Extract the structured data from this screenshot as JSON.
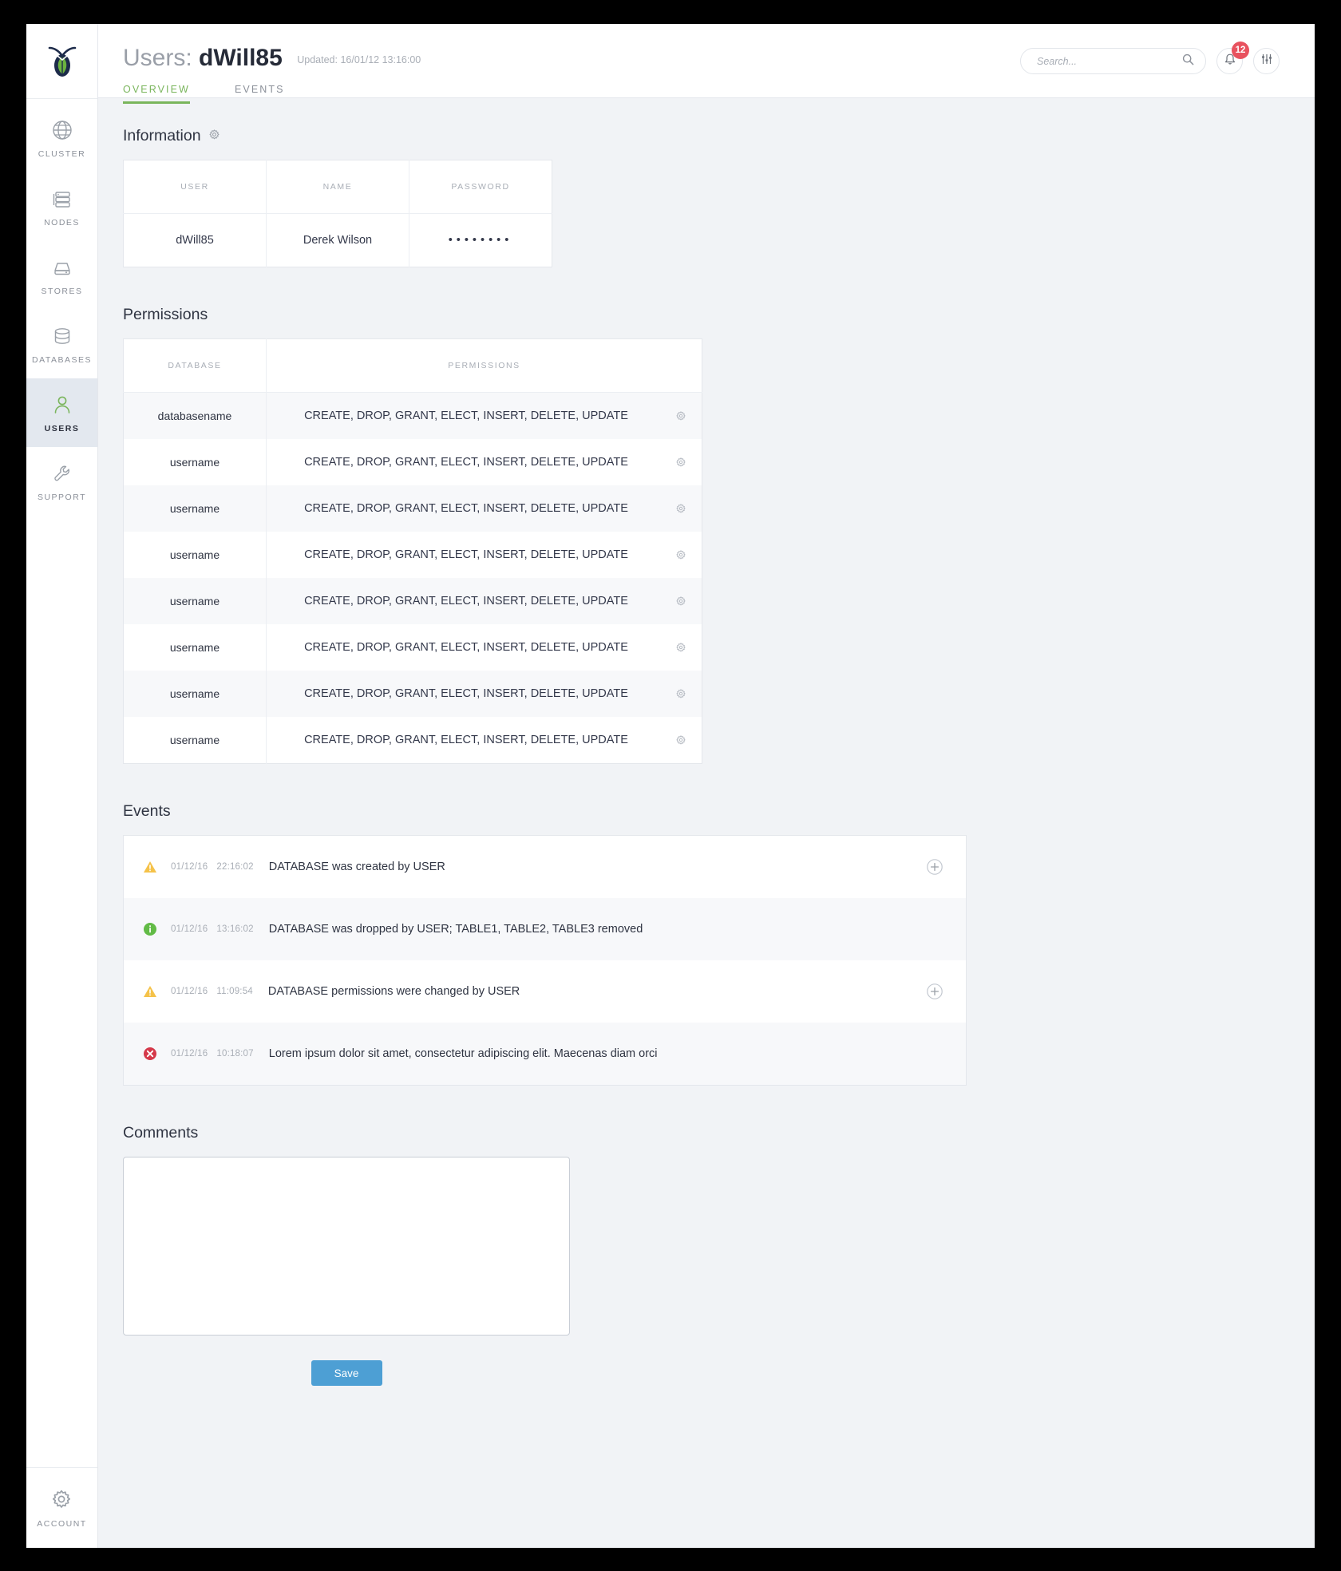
{
  "sidebar": {
    "logo_name": "cockroach-logo",
    "items": [
      {
        "label": "CLUSTER",
        "icon": "globe-icon",
        "active": false
      },
      {
        "label": "NODES",
        "icon": "servers-icon",
        "active": false
      },
      {
        "label": "STORES",
        "icon": "drive-icon",
        "active": false
      },
      {
        "label": "DATABASES",
        "icon": "database-icon",
        "active": false
      },
      {
        "label": "USERS",
        "icon": "user-icon",
        "active": true
      },
      {
        "label": "SUPPORT",
        "icon": "wrench-icon",
        "active": false
      }
    ],
    "account": {
      "label": "ACCOUNT",
      "icon": "gear-icon"
    }
  },
  "header": {
    "title_prefix": "Users:",
    "title_value": "dWill85",
    "updated": "Updated: 16/01/12 13:16:00",
    "tabs": [
      {
        "label": "OVERVIEW",
        "active": true
      },
      {
        "label": "EVENTS",
        "active": false
      }
    ],
    "search": {
      "placeholder": "Search...",
      "value": "",
      "icon": "search-icon"
    },
    "notifications": {
      "icon": "bell-icon",
      "count": "12"
    },
    "settings": {
      "icon": "sliders-icon"
    }
  },
  "information": {
    "title": "Information",
    "gear_icon": "gear-icon",
    "columns": [
      "USER",
      "NAME",
      "PASSWORD"
    ],
    "row": {
      "user": "dWill85",
      "name": "Derek Wilson",
      "password_masked": "••••••••"
    }
  },
  "permissions": {
    "title": "Permissions",
    "columns": [
      "DATABASE",
      "PERMISSIONS"
    ],
    "rows": [
      {
        "database": "databasename",
        "permissions": "CREATE, DROP, GRANT, ELECT, INSERT, DELETE, UPDATE",
        "gear_icon": "gear-icon"
      },
      {
        "database": "username",
        "permissions": "CREATE, DROP, GRANT, ELECT, INSERT, DELETE, UPDATE",
        "gear_icon": "gear-icon"
      },
      {
        "database": "username",
        "permissions": "CREATE, DROP, GRANT, ELECT, INSERT, DELETE, UPDATE",
        "gear_icon": "gear-icon"
      },
      {
        "database": "username",
        "permissions": "CREATE, DROP, GRANT, ELECT, INSERT, DELETE, UPDATE",
        "gear_icon": "gear-icon"
      },
      {
        "database": "username",
        "permissions": "CREATE, DROP, GRANT, ELECT, INSERT, DELETE, UPDATE",
        "gear_icon": "gear-icon"
      },
      {
        "database": "username",
        "permissions": "CREATE, DROP, GRANT, ELECT, INSERT, DELETE, UPDATE",
        "gear_icon": "gear-icon"
      },
      {
        "database": "username",
        "permissions": "CREATE, DROP, GRANT, ELECT, INSERT, DELETE, UPDATE",
        "gear_icon": "gear-icon"
      },
      {
        "database": "username",
        "permissions": "CREATE, DROP, GRANT, ELECT, INSERT, DELETE, UPDATE",
        "gear_icon": "gear-icon"
      }
    ]
  },
  "events": {
    "title": "Events",
    "rows": [
      {
        "severity": "warning",
        "icon": "warning-triangle-icon",
        "date": "01/12/16",
        "time": "22:16:02",
        "text": "DATABASE was created by USER",
        "has_expand": true,
        "expand_icon": "plus-circle-icon"
      },
      {
        "severity": "info",
        "icon": "info-circle-icon",
        "date": "01/12/16",
        "time": "13:16:02",
        "text": "DATABASE was dropped by USER; TABLE1, TABLE2, TABLE3 removed",
        "has_expand": false,
        "expand_icon": "plus-circle-icon"
      },
      {
        "severity": "warning",
        "icon": "warning-triangle-icon",
        "date": "01/12/16",
        "time": "11:09:54",
        "text": "DATABASE permissions were changed by USER",
        "has_expand": true,
        "expand_icon": "plus-circle-icon"
      },
      {
        "severity": "error",
        "icon": "error-circle-icon",
        "date": "01/12/16",
        "time": "10:18:07",
        "text": "Lorem ipsum dolor sit amet, consectetur adipiscing elit. Maecenas diam orci",
        "has_expand": false,
        "expand_icon": "plus-circle-icon"
      }
    ]
  },
  "comments": {
    "title": "Comments",
    "value": "",
    "placeholder": "",
    "save_label": "Save"
  },
  "colors": {
    "accent_green": "#7ab55c",
    "save_blue": "#4d9fd4",
    "badge_red": "#e8525f",
    "warning_yellow": "#f5c249",
    "info_green": "#62bb46",
    "error_red": "#d5394a",
    "page_bg": "#f1f3f6",
    "active_nav_bg": "#e3e8ef"
  }
}
